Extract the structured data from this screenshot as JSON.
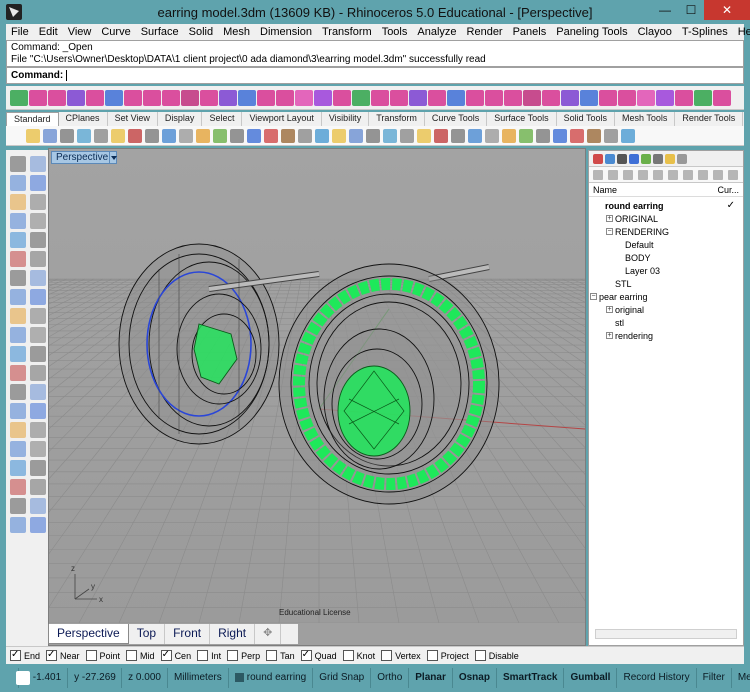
{
  "window": {
    "title": "earring model.3dm (13609 KB) - Rhinoceros 5.0 Educational - [Perspective]",
    "minimize": "—",
    "maximize": "☐",
    "close": "✕"
  },
  "menu": [
    "File",
    "Edit",
    "View",
    "Curve",
    "Surface",
    "Solid",
    "Mesh",
    "Dimension",
    "Transform",
    "Tools",
    "Analyze",
    "Render",
    "Panels",
    "Paneling Tools",
    "Clayoo",
    "T-Splines",
    "Help"
  ],
  "command_history": {
    "line1": "Command: _Open",
    "line2": "File \"C:\\Users\\Owner\\Desktop\\DATA\\1 client project\\0 ada diamond\\3\\earring model.3dm\" successfully read"
  },
  "command_prompt": "Command:",
  "toolbar_tabs": [
    "Standard",
    "CPlanes",
    "Set View",
    "Display",
    "Select",
    "Viewport Layout",
    "Visibility",
    "Transform",
    "Curve Tools",
    "Surface Tools",
    "Solid Tools",
    "Mesh Tools",
    "Render Tools"
  ],
  "viewport": {
    "label": "Perspective",
    "watermark": "Educational License",
    "axis_x": "x",
    "axis_y": "y",
    "axis_z": "z"
  },
  "viewport_tabs": [
    "Perspective",
    "Top",
    "Front",
    "Right",
    "✥"
  ],
  "layers_panel": {
    "col_name": "Name",
    "col_current": "Cur...",
    "check": "✓",
    "layers": [
      {
        "name": "round earring",
        "bold": true,
        "current": true
      },
      {
        "name": "ORIGINAL",
        "expand": "+"
      },
      {
        "name": "RENDERING",
        "expand": "−"
      },
      {
        "name": "Default"
      },
      {
        "name": "BODY"
      },
      {
        "name": "Layer 03"
      },
      {
        "name": "STL"
      },
      {
        "name": "pear earring",
        "expand": "−"
      },
      {
        "name": "original",
        "expand": "+"
      },
      {
        "name": "stl"
      },
      {
        "name": "rendering",
        "expand": "+"
      }
    ]
  },
  "osnaps": [
    {
      "label": "End",
      "checked": true
    },
    {
      "label": "Near",
      "checked": true
    },
    {
      "label": "Point",
      "checked": false
    },
    {
      "label": "Mid",
      "checked": false
    },
    {
      "label": "Cen",
      "checked": true
    },
    {
      "label": "Int",
      "checked": false
    },
    {
      "label": "Perp",
      "checked": false
    },
    {
      "label": "Tan",
      "checked": false
    },
    {
      "label": "Quad",
      "checked": true
    },
    {
      "label": "Knot",
      "checked": false
    },
    {
      "label": "Vertex",
      "checked": false
    },
    {
      "label": "Project",
      "checked": false
    },
    {
      "label": "Disable",
      "checked": false
    }
  ],
  "status": {
    "x": "x -1.401",
    "y": "y -27.269",
    "z": "z 0.000",
    "units": "Millimeters",
    "layer": "round earring",
    "grid_snap": "Grid Snap",
    "ortho": "Ortho",
    "planar": "Planar",
    "osnap": "Osnap",
    "smarttrack": "SmartTrack",
    "gumball": "Gumball",
    "record_history": "Record History",
    "filter": "Filter",
    "memory": "Memory"
  },
  "colors": {
    "accent": "#5fa3ad",
    "gem_green": "#1ee85a",
    "viewport_bg": "#9f9f9f",
    "grid": "#8a8a8a"
  }
}
